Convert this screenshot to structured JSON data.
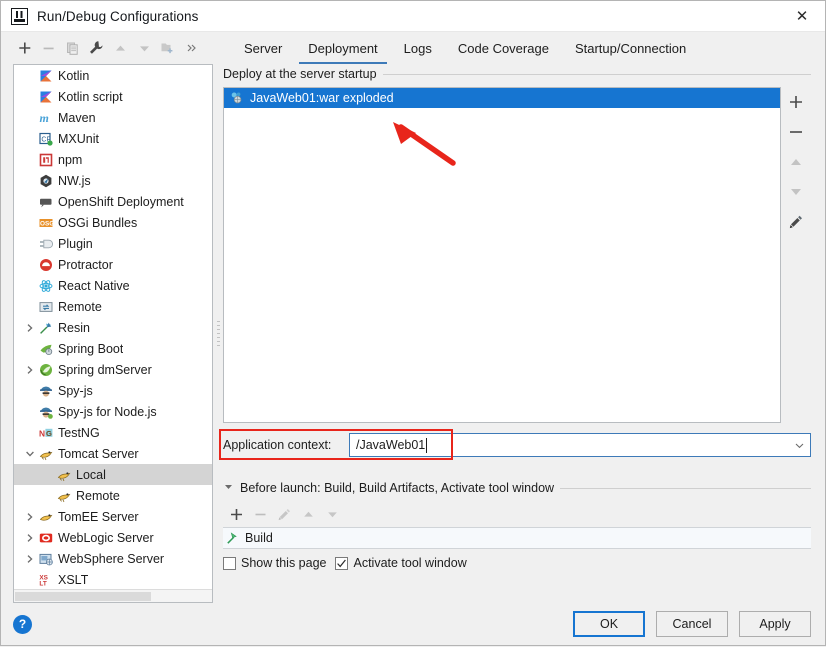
{
  "window": {
    "title": "Run/Debug Configurations",
    "app_icon": "intellij-idea-icon",
    "close_label": "✕"
  },
  "tree_toolbar": {
    "buttons": [
      {
        "name": "add-configuration-button",
        "icon": "plus-icon",
        "enabled": true
      },
      {
        "name": "remove-configuration-button",
        "icon": "minus-icon",
        "enabled": false
      },
      {
        "name": "copy-configuration-button",
        "icon": "copy-icon",
        "enabled": false
      },
      {
        "name": "edit-templates-button",
        "icon": "wrench-icon",
        "enabled": true
      },
      {
        "name": "move-up-button",
        "icon": "arrow-up-icon",
        "enabled": false
      },
      {
        "name": "move-down-button",
        "icon": "arrow-down-icon",
        "enabled": false
      },
      {
        "name": "create-folder-button",
        "icon": "folder-add-icon",
        "enabled": false
      },
      {
        "name": "more-options-button",
        "icon": "chevron-double-right-icon",
        "enabled": true
      }
    ]
  },
  "tabs": [
    {
      "label": "Server",
      "active": false
    },
    {
      "label": "Deployment",
      "active": true
    },
    {
      "label": "Logs",
      "active": false
    },
    {
      "label": "Code Coverage",
      "active": false
    },
    {
      "label": "Startup/Connection",
      "active": false
    }
  ],
  "tree": {
    "items": [
      {
        "label": "Kotlin",
        "icon": "kotlin-icon",
        "indent": 1,
        "expander": "none",
        "selected": false
      },
      {
        "label": "Kotlin script",
        "icon": "kotlin-icon",
        "indent": 1,
        "expander": "none",
        "selected": false
      },
      {
        "label": "Maven",
        "icon": "maven-icon",
        "indent": 1,
        "expander": "none",
        "selected": false
      },
      {
        "label": "MXUnit",
        "icon": "mxunit-icon",
        "indent": 1,
        "expander": "none",
        "selected": false
      },
      {
        "label": "npm",
        "icon": "npm-icon",
        "indent": 1,
        "expander": "none",
        "selected": false
      },
      {
        "label": "NW.js",
        "icon": "nwjs-icon",
        "indent": 1,
        "expander": "none",
        "selected": false
      },
      {
        "label": "OpenShift Deployment",
        "icon": "openshift-icon",
        "indent": 1,
        "expander": "none",
        "selected": false
      },
      {
        "label": "OSGi Bundles",
        "icon": "osgi-icon",
        "indent": 1,
        "expander": "none",
        "selected": false
      },
      {
        "label": "Plugin",
        "icon": "plugin-icon",
        "indent": 1,
        "expander": "none",
        "selected": false
      },
      {
        "label": "Protractor",
        "icon": "protractor-icon",
        "indent": 1,
        "expander": "none",
        "selected": false
      },
      {
        "label": "React Native",
        "icon": "react-native-icon",
        "indent": 1,
        "expander": "none",
        "selected": false
      },
      {
        "label": "Remote",
        "icon": "remote-icon",
        "indent": 1,
        "expander": "none",
        "selected": false
      },
      {
        "label": "Resin",
        "icon": "resin-icon",
        "indent": 1,
        "expander": "collapsed",
        "selected": false
      },
      {
        "label": "Spring Boot",
        "icon": "spring-boot-icon",
        "indent": 1,
        "expander": "none",
        "selected": false
      },
      {
        "label": "Spring dmServer",
        "icon": "spring-dm-icon",
        "indent": 1,
        "expander": "collapsed",
        "selected": false
      },
      {
        "label": "Spy-js",
        "icon": "spy-js-icon",
        "indent": 1,
        "expander": "none",
        "selected": false
      },
      {
        "label": "Spy-js for Node.js",
        "icon": "spy-js-node-icon",
        "indent": 1,
        "expander": "none",
        "selected": false
      },
      {
        "label": "TestNG",
        "icon": "testng-icon",
        "indent": 1,
        "expander": "none",
        "selected": false
      },
      {
        "label": "Tomcat Server",
        "icon": "tomcat-icon",
        "indent": 1,
        "expander": "expanded",
        "selected": false
      },
      {
        "label": "Local",
        "icon": "tomcat-icon",
        "indent": 2,
        "expander": "none",
        "selected": true
      },
      {
        "label": "Remote",
        "icon": "tomcat-icon",
        "indent": 2,
        "expander": "none",
        "selected": false
      },
      {
        "label": "TomEE Server",
        "icon": "tomee-icon",
        "indent": 1,
        "expander": "collapsed",
        "selected": false
      },
      {
        "label": "WebLogic Server",
        "icon": "weblogic-icon",
        "indent": 1,
        "expander": "collapsed",
        "selected": false
      },
      {
        "label": "WebSphere Server",
        "icon": "websphere-icon",
        "indent": 1,
        "expander": "collapsed",
        "selected": false
      },
      {
        "label": "XSLT",
        "icon": "xslt-icon",
        "indent": 1,
        "expander": "none",
        "selected": false
      }
    ]
  },
  "deployment": {
    "group_title": "Deploy at the server startup",
    "artifacts": [
      {
        "label": "JavaWeb01:war exploded",
        "icon": "artifact-icon",
        "selected": true
      }
    ],
    "side_buttons": [
      {
        "name": "add-artifact-button",
        "icon": "plus-icon",
        "enabled": true
      },
      {
        "name": "remove-artifact-button",
        "icon": "minus-icon",
        "enabled": true
      },
      {
        "name": "move-up-button",
        "icon": "arrow-up-icon",
        "enabled": false
      },
      {
        "name": "move-down-button",
        "icon": "arrow-down-icon",
        "enabled": false
      },
      {
        "name": "edit-artifact-button",
        "icon": "pencil-icon",
        "enabled": true
      }
    ],
    "application_context": {
      "label": "Application context:",
      "value": "/JavaWeb01",
      "placeholder": "",
      "dropdown_icon": "chevron-down-icon",
      "highlighted": true
    }
  },
  "before_launch": {
    "group_title": "Before launch: Build, Build Artifacts, Activate tool window",
    "collapse_icon": "triangle-down-icon",
    "toolbar": [
      {
        "name": "add-task-button",
        "icon": "plus-icon",
        "enabled": true
      },
      {
        "name": "remove-task-button",
        "icon": "minus-icon",
        "enabled": false
      },
      {
        "name": "edit-task-button",
        "icon": "pencil-icon",
        "enabled": false
      },
      {
        "name": "move-up-button",
        "icon": "arrow-up-icon",
        "enabled": false
      },
      {
        "name": "move-down-button",
        "icon": "arrow-down-icon",
        "enabled": false
      }
    ],
    "tasks": [
      {
        "label": "Build",
        "icon": "build-hammer-icon"
      }
    ],
    "checkboxes": [
      {
        "label": "Show this page",
        "checked": false
      },
      {
        "label": "Activate tool window",
        "checked": true
      }
    ]
  },
  "footer": {
    "help_label": "?",
    "buttons": [
      {
        "label": "OK",
        "default": true
      },
      {
        "label": "Cancel",
        "default": false
      },
      {
        "label": "Apply",
        "default": false
      }
    ]
  },
  "annotations": {
    "arrow_color": "#e8251b",
    "box_color": "#e8251b"
  }
}
